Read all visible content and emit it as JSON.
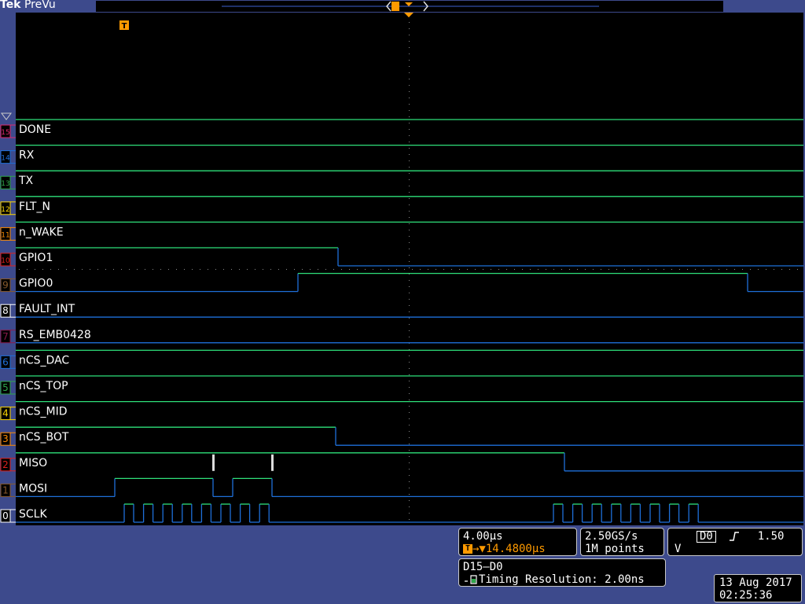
{
  "brand": {
    "vendor": "Tek",
    "mode": "PreVu"
  },
  "trigger_marker_label": "T",
  "channels": [
    {
      "num": "15",
      "label": "DONE",
      "color": "#e0286e"
    },
    {
      "num": "14",
      "label": "RX",
      "color": "#1e6fd9"
    },
    {
      "num": "13",
      "label": "TX",
      "color": "#2ea84a"
    },
    {
      "num": "12",
      "label": "FLT_N",
      "color": "#ffd800"
    },
    {
      "num": "11",
      "label": "n_WAKE",
      "color": "#ff8c00"
    },
    {
      "num": "10",
      "label": "GPIO1",
      "color": "#e0201c"
    },
    {
      "num": "9",
      "label": "GPIO0",
      "color": "#8a5a2b"
    },
    {
      "num": "8",
      "label": "FAULT_INT",
      "color": "#ffffff"
    },
    {
      "num": "7",
      "label": "RS_EMB0428",
      "color": "#8b1a4a"
    },
    {
      "num": "6",
      "label": "nCS_DAC",
      "color": "#1e6fd9"
    },
    {
      "num": "5",
      "label": "nCS_TOP",
      "color": "#2ea84a"
    },
    {
      "num": "4",
      "label": "nCS_MID",
      "color": "#ffd800"
    },
    {
      "num": "3",
      "label": "nCS_BOT",
      "color": "#ff8c00"
    },
    {
      "num": "2",
      "label": "MISO",
      "color": "#e0201c"
    },
    {
      "num": "1",
      "label": "MOSI",
      "color": "#8a5a2b"
    },
    {
      "num": "0",
      "label": "SCLK",
      "color": "#ffffff"
    }
  ],
  "horizontal": {
    "scale": "4.00µs",
    "position": "14.4800µs"
  },
  "acquisition": {
    "sample_rate": "2.50GS/s",
    "record_length": "1M points"
  },
  "trigger": {
    "source": "D0",
    "slope_icon": "rising-edge-icon",
    "level": "1.50 V"
  },
  "bus": {
    "range": "D15–D0",
    "timing_resolution": "Timing Resolution: 2.00ns"
  },
  "datetime": {
    "date": "13 Aug 2017",
    "time": "02:25:36"
  },
  "colors": {
    "high": "#2ee07a",
    "low": "#1e6fd9",
    "accent": "#ff9a00",
    "frame": "#3d4a8c"
  }
}
